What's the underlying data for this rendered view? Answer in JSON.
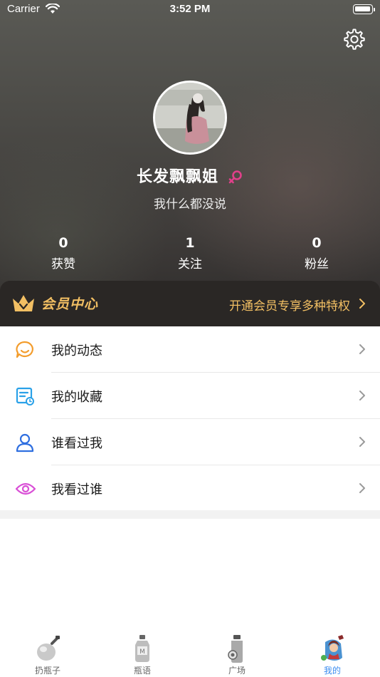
{
  "status_bar": {
    "carrier": "Carrier",
    "time": "3:52 PM"
  },
  "profile": {
    "name": "长发飘飘姐",
    "bio": "我什么都没说",
    "gender_icon": "female-icon",
    "gender_color": "#e0408a"
  },
  "stats": [
    {
      "value": "0",
      "label": "获赞"
    },
    {
      "value": "1",
      "label": "关注"
    },
    {
      "value": "0",
      "label": "粉丝"
    }
  ],
  "vip": {
    "title": "会员中心",
    "promo": "开通会员专享多种特权",
    "accent": "#f2bf63"
  },
  "menu": [
    {
      "label": "我的动态",
      "icon": "smiley-chat-icon",
      "color": "#f39c2b"
    },
    {
      "label": "我的收藏",
      "icon": "favorites-card-icon",
      "color": "#2aa1e8"
    },
    {
      "label": "谁看过我",
      "icon": "person-icon",
      "color": "#2f6fe0"
    },
    {
      "label": "我看过谁",
      "icon": "eye-icon",
      "color": "#d94fd6"
    }
  ],
  "tabs": [
    {
      "label": "扔瓶子",
      "icon": "throw-bottle-icon",
      "active": false
    },
    {
      "label": "瓶语",
      "icon": "bottle-message-icon",
      "active": false
    },
    {
      "label": "广场",
      "icon": "plaza-icon",
      "active": false
    },
    {
      "label": "我的",
      "icon": "profile-tab-icon",
      "active": true
    }
  ],
  "active_tab_color": "#3a8cf0"
}
